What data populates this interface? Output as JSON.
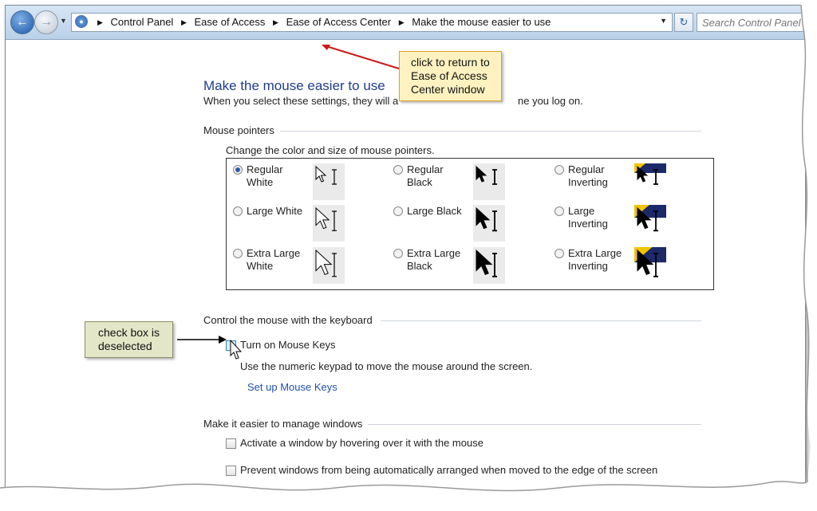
{
  "address_bar": {
    "crumbs": [
      "Control Panel",
      "Ease of Access",
      "Ease of Access Center",
      "Make the mouse easier to use"
    ],
    "search_placeholder": "Search Control Panel"
  },
  "page": {
    "title": "Make the mouse easier to use",
    "description_start": "When you select these settings, they will a",
    "description_end": "ne you log on."
  },
  "mouse_pointers": {
    "heading": "Mouse pointers",
    "instruction": "Change the color and size of mouse pointers.",
    "options": [
      {
        "label_line1": "Regular",
        "label_line2": "White",
        "selected": true,
        "style": "white",
        "size": "regular"
      },
      {
        "label_line1": "Regular Black",
        "label_line2": "",
        "selected": false,
        "style": "black",
        "size": "regular"
      },
      {
        "label_line1": "Regular",
        "label_line2": "Inverting",
        "selected": false,
        "style": "inverting",
        "size": "regular"
      },
      {
        "label_line1": "Large White",
        "label_line2": "",
        "selected": false,
        "style": "white",
        "size": "large"
      },
      {
        "label_line1": "Large Black",
        "label_line2": "",
        "selected": false,
        "style": "black",
        "size": "large"
      },
      {
        "label_line1": "Large",
        "label_line2": "Inverting",
        "selected": false,
        "style": "inverting",
        "size": "large"
      },
      {
        "label_line1": "Extra Large",
        "label_line2": "White",
        "selected": false,
        "style": "white",
        "size": "xlarge"
      },
      {
        "label_line1": "Extra Large",
        "label_line2": "Black",
        "selected": false,
        "style": "black",
        "size": "xlarge"
      },
      {
        "label_line1": "Extra Large",
        "label_line2": "Inverting",
        "selected": false,
        "style": "inverting",
        "size": "xlarge"
      }
    ]
  },
  "keyboard": {
    "heading": "Control the mouse with the keyboard",
    "mouse_keys_label": "Turn on Mouse Keys",
    "mouse_keys_checked": false,
    "mouse_keys_help": "Use the numeric keypad to move the mouse around the screen.",
    "setup_link": "Set up Mouse Keys"
  },
  "windows": {
    "heading": "Make it easier to manage windows",
    "hover_label": "Activate a window by hovering over it with the mouse",
    "hover_checked": false,
    "prevent_label": "Prevent windows from being automatically arranged when moved to the edge of the screen",
    "prevent_checked": false
  },
  "callouts": {
    "return_line1": "click to return to",
    "return_line2": "Ease of Access",
    "return_line3": "Center window",
    "checkbox_line1": "check box is",
    "checkbox_line2": "deselected"
  },
  "colors": {
    "accent_link": "#1f4fb0",
    "title": "#1e3c8c",
    "callout_red": "#cc1a1a",
    "callout_yellow": "#fff2c0",
    "callout_olive": "#e4e6c8",
    "inverting_yellow": "#f0c400",
    "inverting_navy": "#1c2a6a"
  }
}
